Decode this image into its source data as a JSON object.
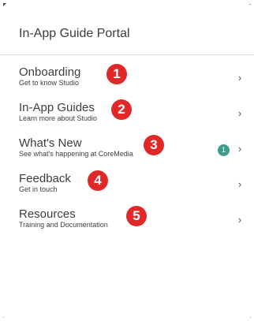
{
  "header": {
    "title": "In-App Guide Portal"
  },
  "menu": {
    "items": [
      {
        "title": "Onboarding",
        "subtitle": "Get to know Studio",
        "step": "1",
        "chevron": "›"
      },
      {
        "title": "In-App Guides",
        "subtitle": "Learn more about Studio",
        "step": "2",
        "chevron": "›"
      },
      {
        "title": "What's New",
        "subtitle": "See what's happening at CoreMedia",
        "step": "3",
        "badge": "1",
        "chevron": "›"
      },
      {
        "title": "Feedback",
        "subtitle": "Get in touch",
        "step": "4",
        "chevron": "›"
      },
      {
        "title": "Resources",
        "subtitle": "Training and Documentation",
        "step": "5",
        "chevron": "›"
      }
    ]
  },
  "colors": {
    "step_marker": "#e02828",
    "badge": "#3f9b8a",
    "divider": "#dddddd"
  },
  "icons": {
    "chevron": "chevron-right-icon"
  }
}
